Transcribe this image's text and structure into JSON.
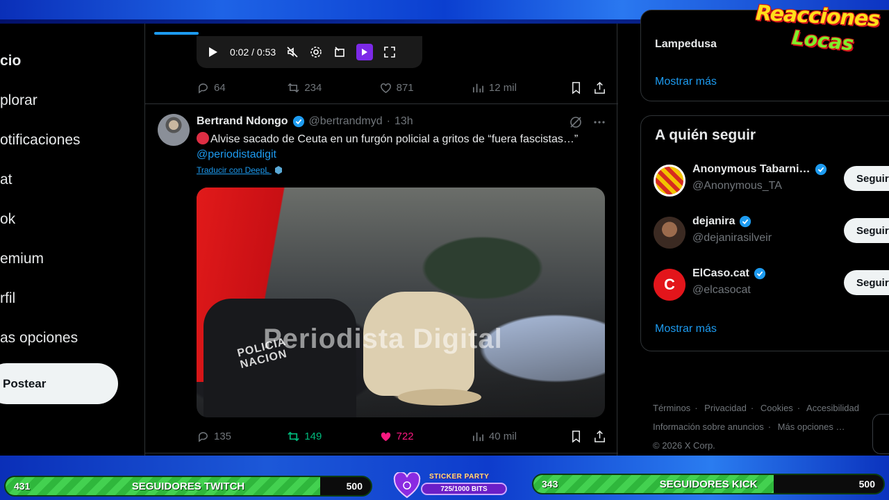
{
  "overlay": {
    "logo_line1": "Reacciones",
    "logo_line2": "Locas",
    "twitch_bar": {
      "current": "431",
      "label": "SEGUIDORES TWITCH",
      "goal": "500",
      "progress": 0.862
    },
    "kick_bar": {
      "current": "343",
      "label": "SEGUIDORES KICK",
      "goal": "500",
      "progress": 0.686
    },
    "sticker_party": {
      "title": "STICKER PARTY",
      "progress_text": "725/1000 BITS"
    }
  },
  "nav": {
    "items": [
      "cio",
      "plorar",
      "otificaciones",
      "at",
      "ok",
      "emium",
      "rfil",
      "as opciones"
    ],
    "post_label": "Postear"
  },
  "player": {
    "time": "0:02 / 0:53"
  },
  "prev_tweet_actions": {
    "replies": "64",
    "reposts": "234",
    "likes": "871",
    "views": "12 mil"
  },
  "tweet": {
    "name": "Bertrand Ndongo",
    "handle": "@bertrandmyd",
    "dot": "·",
    "time": "13h",
    "text": "Alvise sacado de Ceuta en un furgón policial a gritos de “fuera fascistas…”",
    "mention": "@periodistadigit",
    "translate": "Traducir con DeepL",
    "media_watermark": "Periodista Digital",
    "media_text_1": "POLICIA",
    "media_text_2": "NACION",
    "actions": {
      "replies": "135",
      "reposts": "149",
      "likes": "722",
      "views": "40 mil"
    }
  },
  "trends": {
    "last_item": "Lampedusa",
    "more": "Mostrar más"
  },
  "who_to_follow": {
    "title": "A quién seguir",
    "follow_label": "Seguir",
    "accounts": [
      {
        "name": "Anonymous Tabarni…",
        "handle": "@Anonymous_TA"
      },
      {
        "name": "dejanira",
        "handle": "@dejanirasilveir"
      },
      {
        "name": "ElCaso.cat",
        "handle": "@elcasocat",
        "avatar_letter": "C"
      }
    ],
    "more": "Mostrar más"
  },
  "footer": {
    "links": [
      "Términos",
      "Privacidad",
      "Cookies",
      "Accesibilidad",
      "Información sobre anuncios",
      "Más opciones …"
    ],
    "copyright": "© 2026 X Corp."
  },
  "colors": {
    "accent": "#1d9bf0",
    "repost_active": "#00ba7c",
    "like_active": "#f91880",
    "progress_green": "#43d150"
  }
}
